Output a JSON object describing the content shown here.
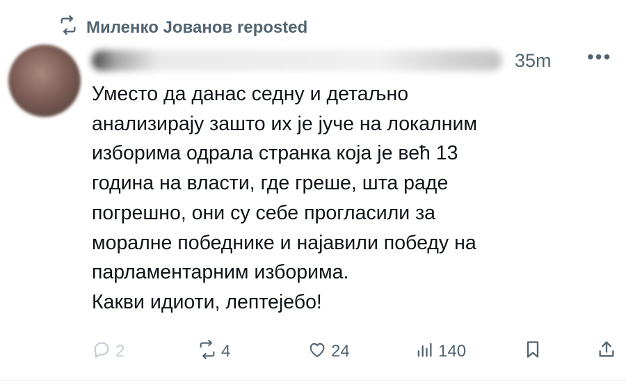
{
  "repost": {
    "icon": "repost-icon",
    "text": "Миленко Jованов reposted"
  },
  "post": {
    "author_name": "",
    "time": "35m",
    "more_label": "•••",
    "lines": [
      "Уместо да данас седну и детаљно",
      "анализирају зашто их је јуче на локалним",
      "изборима одрала странка која је већ 13",
      "година на власти, где греше, шта раде",
      "погрешно, они су себе прогласили за",
      "моралне победнике и најавили победу на",
      "парламентарним изборима.",
      "Какви идиоти, лептејебо!"
    ]
  },
  "actions": {
    "replies": "2",
    "reposts": "4",
    "likes": "24",
    "views": "140",
    "bookmark_icon": "bookmark-icon",
    "share_icon": "share-icon"
  },
  "colors": {
    "text": "#0f1419",
    "muted": "#536471",
    "faded": "#c5ccd2"
  }
}
